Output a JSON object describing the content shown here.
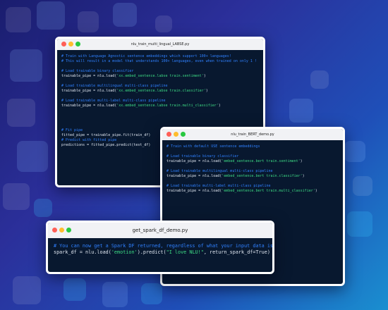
{
  "windows": {
    "w1": {
      "title": "nlu_train_multi_lingual_LABSE.py",
      "lines": [
        {
          "type": "comment",
          "text": "# Train with Language Agnostic sentence embeddings which support 100+ languages!"
        },
        {
          "type": "comment",
          "text": "# This will result in a model that understands 100+ languages, even when trained on only 1 !"
        },
        {
          "type": "blank",
          "text": ""
        },
        {
          "type": "comment",
          "text": "# Load trainable binary classifier"
        },
        {
          "type": "code",
          "pre": "trainable_pipe = nlu.load(",
          "str": "'xx.embed_sentence.labse train.sentiment'",
          "post": ")"
        },
        {
          "type": "blank",
          "text": ""
        },
        {
          "type": "comment",
          "text": "# Load trainable multilingual multi-class pipeline"
        },
        {
          "type": "code",
          "pre": "trainable_pipe = nlu.load(",
          "str": "'xx.embed_sentence.labse train.classifier'",
          "post": ")"
        },
        {
          "type": "blank",
          "text": ""
        },
        {
          "type": "comment",
          "text": "# Load trainable multi-label multi-class pipeline"
        },
        {
          "type": "code",
          "pre": "trainable_pipe = nlu.load(",
          "str": "'xx.embed_sentence.labse train.multi_classifier'",
          "post": ")"
        },
        {
          "type": "blank",
          "text": ""
        },
        {
          "type": "blank",
          "text": ""
        },
        {
          "type": "blank",
          "text": ""
        },
        {
          "type": "blank",
          "text": ""
        },
        {
          "type": "comment",
          "text": "# Fit pipe"
        },
        {
          "type": "code",
          "pre": "fitted_pipe = trainable_pipe.fit(train_df)",
          "str": "",
          "post": ""
        },
        {
          "type": "comment",
          "text": "# Predict with fitted pipe"
        },
        {
          "type": "code",
          "pre": "predictions = fitted_pipe.predict(test_df)",
          "str": "",
          "post": ""
        }
      ]
    },
    "w2": {
      "title": "nlu_train_BERT_demo.py",
      "lines": [
        {
          "type": "comment",
          "text": "# Train with default USE sentence embeddings"
        },
        {
          "type": "blank",
          "text": ""
        },
        {
          "type": "comment",
          "text": "# Load trainable binary classifier"
        },
        {
          "type": "code",
          "pre": "trainable_pipe = nlu.load(",
          "str": "'embed_sentence.bert train.sentiment'",
          "post": ")"
        },
        {
          "type": "blank",
          "text": ""
        },
        {
          "type": "comment",
          "text": "# Load trainable multilingual multi-class pipeline"
        },
        {
          "type": "code",
          "pre": "trainable_pipe = nlu.load(",
          "str": "'embed_sentence.bert train.classifier'",
          "post": ")"
        },
        {
          "type": "blank",
          "text": ""
        },
        {
          "type": "comment",
          "text": "# Load trainable multi-label multi-class pipeline"
        },
        {
          "type": "code",
          "pre": "trainable_pipe = nlu.load(",
          "str": "'embed_sentence.bert train.multi_classifier'",
          "post": ")"
        }
      ]
    },
    "w3": {
      "title": "get_spark_df_demo.py",
      "lines": [
        {
          "type": "comment",
          "text": "# You can now get a Spark DF returned, regardless of what your input data is!"
        },
        {
          "type": "code",
          "pre": "spark_df = nlu.load(",
          "str": "'emotion'",
          "mid": ").predict(",
          "str2": "\"I love NLU!\"",
          "post": ", return_spark_df=True)"
        }
      ]
    }
  },
  "colors": {
    "comment": "#2f80ff",
    "string": "#3ddc84",
    "text": "#dfe6f0",
    "editor_bg": "#08182f"
  },
  "icons": [
    "close-dot-icon",
    "minimize-dot-icon",
    "maximize-dot-icon"
  ]
}
